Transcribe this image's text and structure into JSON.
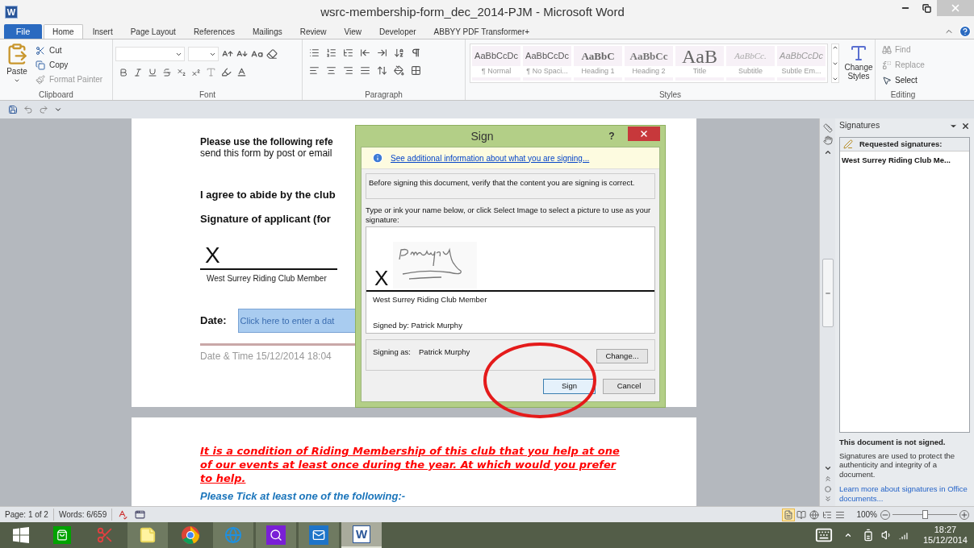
{
  "window": {
    "icon_letter": "W",
    "title": "wsrc-membership-form_dec_2014-PJM - Microsoft Word"
  },
  "ribbon_tabs": [
    {
      "label": "File",
      "kind": "file",
      "selected": false
    },
    {
      "label": "Home",
      "kind": "tab",
      "selected": true
    },
    {
      "label": "Insert",
      "kind": "tab",
      "selected": false
    },
    {
      "label": "Page Layout",
      "kind": "tab",
      "selected": false
    },
    {
      "label": "References",
      "kind": "tab",
      "selected": false
    },
    {
      "label": "Mailings",
      "kind": "tab",
      "selected": false
    },
    {
      "label": "Review",
      "kind": "tab",
      "selected": false
    },
    {
      "label": "View",
      "kind": "tab",
      "selected": false
    },
    {
      "label": "Developer",
      "kind": "tab",
      "selected": false
    },
    {
      "label": "ABBYY PDF Transformer+",
      "kind": "tab",
      "selected": false
    }
  ],
  "ribbon": {
    "clipboard": {
      "label": "Clipboard",
      "paste": "Paste",
      "items": [
        {
          "label": "Cut",
          "kind": "cut",
          "disabled": false
        },
        {
          "label": "Copy",
          "kind": "copy",
          "disabled": false
        },
        {
          "label": "Format Painter",
          "kind": "painter",
          "disabled": true
        }
      ]
    },
    "font": {
      "label": "Font"
    },
    "paragraph": {
      "label": "Paragraph"
    },
    "styles": {
      "label": "Styles",
      "items": [
        {
          "preview": "AaBbCcDc",
          "name": "¶ Normal",
          "kind": "body"
        },
        {
          "preview": "AaBbCcDc",
          "name": "¶ No Spaci...",
          "kind": "body"
        },
        {
          "preview": "AaBbC",
          "name": "Heading 1",
          "kind": "heading1"
        },
        {
          "preview": "AaBbCc",
          "name": "Heading 2",
          "kind": "heading2"
        },
        {
          "preview": "AaB",
          "name": "Title",
          "kind": "title"
        },
        {
          "preview": "AaBbCc.",
          "name": "Subtitle",
          "kind": "subtitle"
        },
        {
          "preview": "AaBbCcDc",
          "name": "Subtle Em...",
          "kind": "emphasis"
        }
      ],
      "change_styles": "Change Styles"
    },
    "editing": {
      "label": "Editing",
      "items": [
        {
          "label": "Find",
          "kind": "find",
          "disabled": true
        },
        {
          "label": "Replace",
          "kind": "replace",
          "disabled": true
        },
        {
          "label": "Select",
          "kind": "select",
          "disabled": false
        }
      ]
    }
  },
  "document": {
    "page1": {
      "reference_line": "Please use the following refe",
      "send_line": "send this form by post or email",
      "agree_line": "I agree to abide by the club",
      "signature_heading": "Signature of applicant (for",
      "signature_mark": "X",
      "signer_title": "West Surrey Riding Club Member",
      "date_label": "Date:",
      "date_field": {
        "placeholder": "Click here to enter a dat"
      },
      "date_time": "Date & Time 15/12/2014 18:04"
    },
    "page2": {
      "condition_text": "It is a condition of Riding Membership of this club that you help at one of our events at least once during the year. At which would you prefer to help.",
      "tick_heading": "Please Tick at least one of the following:-"
    }
  },
  "sign_dialog": {
    "title": "Sign",
    "help": "?",
    "info_link": "See additional information about what you are signing...",
    "verify_note": "Before signing this document, verify that the content you are signing is correct.",
    "instructions": "Type or ink your name below, or click Select Image to select a picture to use as your signature:",
    "signature_mark": "X",
    "signer_title": "West Surrey Riding Club Member",
    "signed_by": "Signed by: Patrick Murphy",
    "signing_as_label": "Signing as:",
    "signing_as_name": "Patrick Murphy",
    "change_button": "Change...",
    "buttons": [
      {
        "label": "Sign",
        "default": true
      },
      {
        "label": "Cancel",
        "default": false
      }
    ]
  },
  "signatures_pane": {
    "title": "Signatures",
    "requested_header": "Requested signatures:",
    "requested": [
      {
        "label": "West Surrey Riding Club Me..."
      }
    ],
    "status": "This document is not signed.",
    "description": "Signatures are used to protect the authenticity and integrity of a document.",
    "learn_more_link": "Learn more about signatures in Office documents..."
  },
  "status_bar": {
    "page": "Page: 1 of 2",
    "words": "Words: 6/659",
    "views": [
      {
        "kind": "print",
        "selected": true
      },
      {
        "kind": "reading",
        "selected": false
      },
      {
        "kind": "web",
        "selected": false
      },
      {
        "kind": "outline",
        "selected": false
      },
      {
        "kind": "draft",
        "selected": false
      }
    ],
    "zoom": "100%",
    "zoom_slider": {
      "level": 0.5
    }
  },
  "taskbar": {
    "apps": [
      {
        "kind": "store",
        "running": false,
        "selected": false
      },
      {
        "kind": "snipping",
        "running": false,
        "selected": false
      },
      {
        "kind": "notes",
        "running": true,
        "selected": false
      },
      {
        "kind": "chrome",
        "running": false,
        "selected": false
      },
      {
        "kind": "browser",
        "running": true,
        "selected": false
      },
      {
        "kind": "search",
        "running": true,
        "selected": false
      },
      {
        "kind": "mail",
        "running": true,
        "selected": false
      },
      {
        "kind": "word",
        "running": true,
        "selected": true,
        "letter": "W"
      }
    ],
    "time": "18:27",
    "date": "15/12/2014"
  }
}
